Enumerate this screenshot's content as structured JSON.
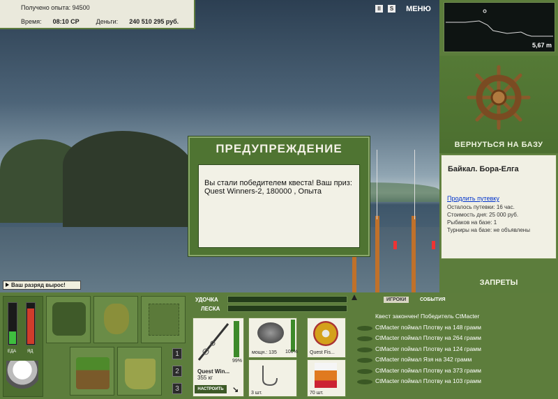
{
  "hud": {
    "experience_label": "Получено опыта:",
    "experience_value": "94500",
    "time_label": "Время:",
    "time_value": "08:10 СР",
    "money_label": "Деньги:",
    "money_value": "240 510 295 руб.",
    "menu_label": "МЕНЮ",
    "pause_icon": "II",
    "sound_icon": "S"
  },
  "depth_map": {
    "depth": "5,67 m"
  },
  "right_panel": {
    "return_base": "ВЕРНУТЬСЯ НА БАЗУ",
    "location": "Байкал. Бора-Елга",
    "extend_link": "Продлить путевку",
    "remaining": "Осталось путевки: 16 час.",
    "day_cost": "Стоимость дня: 25 000 руб.",
    "fishers": "Рыбаков на базе: 1",
    "tournaments": "Турниры на базе: не объявлены",
    "bans": "ЗАПРЕТЫ"
  },
  "dialog": {
    "title": "ПРЕДУПРЕЖДЕНИЕ",
    "message": "Вы стали победителем квеста! Ваш приз: Quest Winners-2, 180000 , Опыта"
  },
  "rank_banner": "Ваш разряд вырос!",
  "status": {
    "food_label": "ЕДА",
    "poison_label": "ЯД",
    "food_level": 0.3,
    "poison_level": 0.85
  },
  "slots": {
    "numbers": [
      "1",
      "2",
      "3"
    ]
  },
  "tackle": {
    "rod_label": "УДОЧКА",
    "line_label": "ЛЕСКА",
    "rod_name": "Quest Win...",
    "rod_weight": "355 кг",
    "rod_percent": "99%",
    "setup_button": "НАСТРОИТЬ",
    "reel_power": "мощн.: 135",
    "reel_percent": "100%",
    "line_name": "Quest Fis...",
    "hooks": "3 шт.",
    "bait": "70 шт."
  },
  "events": {
    "tab_players": "ИГРОКИ",
    "tab_events": "СОБЫТИЯ",
    "lines": [
      "Квест закончен! Победитель CtMacter",
      "CtMacter поймал Плотву на 148 грамм",
      "CtMacter поймал Плотву на 264 грамм",
      "CtMacter поймал Плотву на 124 грамм",
      "CtMacter поймал Язя на 342 грамм",
      "CtMacter поймал Плотву на 373 грамм",
      "CtMacter поймал Плотву на 103 грамм"
    ]
  }
}
